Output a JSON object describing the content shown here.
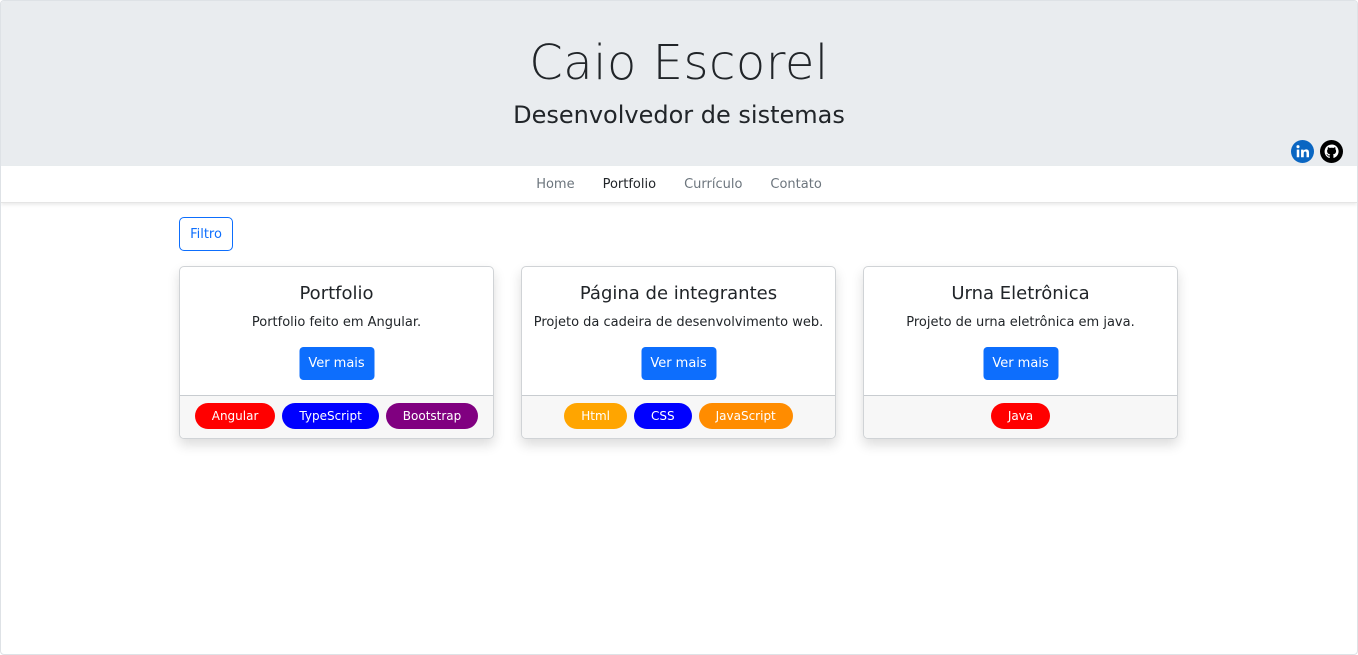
{
  "header": {
    "title": "Caio Escorel",
    "subtitle": "Desenvolvedor de sistemas",
    "social": [
      {
        "icon": "linkedin-icon",
        "color": "#0a66c2"
      },
      {
        "icon": "github-icon",
        "color": "#000000"
      }
    ]
  },
  "nav": {
    "items": [
      {
        "label": "Home",
        "active": false
      },
      {
        "label": "Portfolio",
        "active": true
      },
      {
        "label": "Currículo",
        "active": false
      },
      {
        "label": "Contato",
        "active": false
      }
    ]
  },
  "filter": {
    "label": "Filtro"
  },
  "colors": {
    "primary": "#0d6efd",
    "hero_bg": "#e9ecef",
    "tag_red": "#ff0000",
    "tag_blue": "#0000ff",
    "tag_purple": "#800080",
    "tag_orange": "#ffa500",
    "tag_darkorange": "#ff8c00"
  },
  "cards": [
    {
      "title": "Portfolio",
      "text": "Portfolio feito em Angular.",
      "button": "Ver mais",
      "tags": [
        {
          "label": "Angular",
          "color": "#ff0000"
        },
        {
          "label": "TypeScript",
          "color": "#0000ff"
        },
        {
          "label": "Bootstrap",
          "color": "#800080"
        }
      ]
    },
    {
      "title": "Página de integrantes",
      "text": "Projeto da cadeira de desenvolvimento web.",
      "button": "Ver mais",
      "tags": [
        {
          "label": "Html",
          "color": "#ffa500"
        },
        {
          "label": "CSS",
          "color": "#0000ff"
        },
        {
          "label": "JavaScript",
          "color": "#ff8c00"
        }
      ]
    },
    {
      "title": "Urna Eletrônica",
      "text": "Projeto de urna eletrônica em java.",
      "button": "Ver mais",
      "tags": [
        {
          "label": "Java",
          "color": "#ff0000"
        }
      ]
    }
  ]
}
